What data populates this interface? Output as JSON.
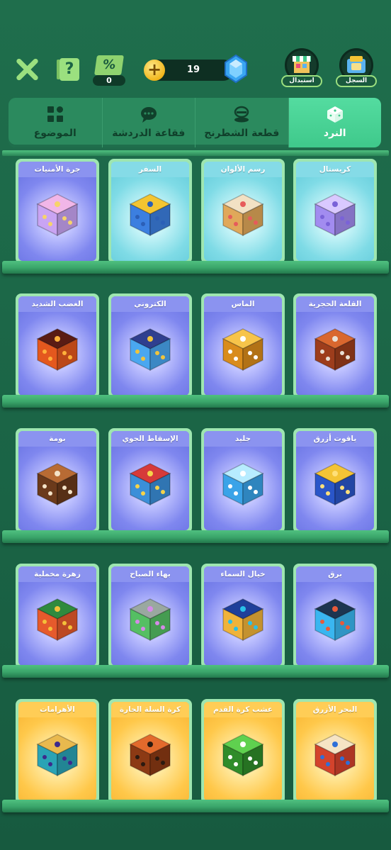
{
  "header": {
    "percent_count": "0",
    "coins": "19",
    "shop_label": "استبدال",
    "history_label": "السجل"
  },
  "tabs": [
    {
      "label": "الموضوع",
      "icon": "grid-icon",
      "active": false
    },
    {
      "label": "فقاعة الدردشة",
      "icon": "chat-bubble-icon",
      "active": false
    },
    {
      "label": "قطعة الشطرنج",
      "icon": "chess-piece-icon",
      "active": false
    },
    {
      "label": "النرد",
      "icon": "dice-icon",
      "active": true
    }
  ],
  "shelves": [
    [
      {
        "title": "جرة الأمنيات",
        "style": "blue",
        "icon": "wish-jar-dice-icon"
      },
      {
        "title": "السفر",
        "style": "cyan",
        "icon": "travel-dice-icon"
      },
      {
        "title": "رسم الألوان",
        "style": "cyan",
        "icon": "color-painting-dice-icon"
      },
      {
        "title": "كريستال",
        "style": "cyan",
        "icon": "crystal-dice-icon"
      }
    ],
    [
      {
        "title": "الغضب الشديد",
        "style": "blue",
        "icon": "fury-dice-icon"
      },
      {
        "title": "الكتروني",
        "style": "blue",
        "icon": "electronic-dice-icon"
      },
      {
        "title": "الماس",
        "style": "blue",
        "icon": "diamond-dice-icon"
      },
      {
        "title": "القلعة الحجرية",
        "style": "blue",
        "icon": "stone-castle-dice-icon"
      }
    ],
    [
      {
        "title": "بومة",
        "style": "blue",
        "icon": "owl-dice-icon"
      },
      {
        "title": "الإسقاط الجوي",
        "style": "blue",
        "icon": "airdrop-dice-icon"
      },
      {
        "title": "جليد",
        "style": "blue",
        "icon": "ice-dice-icon"
      },
      {
        "title": "ياقوت أزرق",
        "style": "blue",
        "icon": "sapphire-dice-icon"
      }
    ],
    [
      {
        "title": "زهرة مخملية",
        "style": "blue",
        "icon": "velvet-flower-dice-icon"
      },
      {
        "title": "بهاء الصباح",
        "style": "blue",
        "icon": "morning-glory-dice-icon"
      },
      {
        "title": "خيال السماء",
        "style": "blue",
        "icon": "sky-fantasy-dice-icon"
      },
      {
        "title": "برق",
        "style": "blue",
        "icon": "lightning-dice-icon"
      }
    ],
    [
      {
        "title": "الأهرامات",
        "style": "gold",
        "icon": "pyramids-dice-icon"
      },
      {
        "title": "كرة السلة الحارة",
        "style": "gold",
        "icon": "hot-basketball-dice-icon"
      },
      {
        "title": "عشب كرة القدم",
        "style": "gold",
        "icon": "football-grass-dice-icon"
      },
      {
        "title": "البحر الأزرق",
        "style": "gold",
        "icon": "blue-sea-dice-icon"
      }
    ]
  ],
  "dice_colors": {
    "wish-jar-dice-icon": [
      "#f1b6e8",
      "#c9a4f3",
      "#f7d36a"
    ],
    "travel-dice-icon": [
      "#f4c531",
      "#3c7fe0",
      "#2b5fb7"
    ],
    "color-painting-dice-icon": [
      "#f2e1c4",
      "#e0a85a",
      "#e65b5b"
    ],
    "crystal-dice-icon": [
      "#d9c9ff",
      "#a28cf0",
      "#7a62d8"
    ],
    "fury-dice-icon": [
      "#5a1c14",
      "#e4581e",
      "#ffb13b"
    ],
    "electronic-dice-icon": [
      "#2f3f8f",
      "#4aa7f0",
      "#f0c43c"
    ],
    "diamond-dice-icon": [
      "#f7c44a",
      "#d98c1c",
      "#ffffff"
    ],
    "stone-castle-dice-icon": [
      "#d9672e",
      "#9d3d1c",
      "#e9e0d6"
    ],
    "owl-dice-icon": [
      "#b86b34",
      "#6b3a1b",
      "#f4e3c8"
    ],
    "airdrop-dice-icon": [
      "#d63a3a",
      "#3b8fd9",
      "#f5d34a"
    ],
    "ice-dice-icon": [
      "#b7ecff",
      "#3aa3e8",
      "#ffffff"
    ],
    "sapphire-dice-icon": [
      "#f4c435",
      "#2a56c9",
      "#ffe07a"
    ],
    "velvet-flower-dice-icon": [
      "#2f8a3e",
      "#e65a2c",
      "#f4c03a"
    ],
    "morning-glory-dice-icon": [
      "#9aa8a0",
      "#55bf63",
      "#d58ae8"
    ],
    "sky-fantasy-dice-icon": [
      "#1f3f9a",
      "#f0b33a",
      "#2ac0e8"
    ],
    "lightning-dice-icon": [
      "#1d3550",
      "#3ab6f0",
      "#e85a3a"
    ],
    "pyramids-dice-icon": [
      "#e9b94e",
      "#2aa3b5",
      "#3c2a8c"
    ],
    "hot-basketball-dice-icon": [
      "#e36a2c",
      "#8c3a14",
      "#2b1a10"
    ],
    "football-grass-dice-icon": [
      "#5fd14f",
      "#2f8c2a",
      "#ffffff"
    ],
    "blue-sea-dice-icon": [
      "#f6e4c5",
      "#d3432c",
      "#2f6fd8"
    ]
  }
}
